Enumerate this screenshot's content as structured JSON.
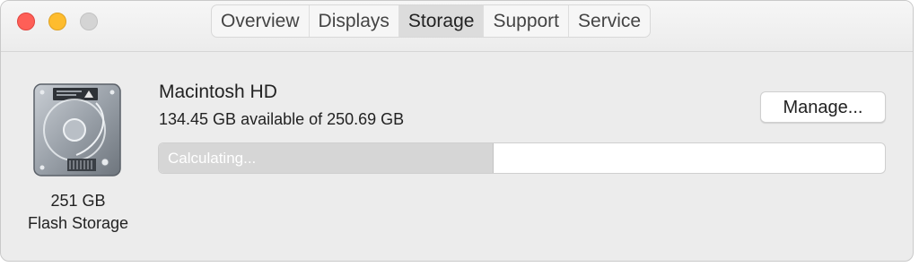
{
  "window": {
    "traffic_lights": {
      "close": "#fe5f57",
      "minimize": "#febc2e",
      "zoom": "#d4d4d4"
    }
  },
  "tabs": [
    {
      "label": "Overview",
      "active": false
    },
    {
      "label": "Displays",
      "active": false
    },
    {
      "label": "Storage",
      "active": true
    },
    {
      "label": "Support",
      "active": false
    },
    {
      "label": "Service",
      "active": false
    }
  ],
  "disk": {
    "icon": "hard-drive-icon",
    "size": "251 GB",
    "type": "Flash Storage"
  },
  "volume": {
    "name": "Macintosh HD",
    "available": "134.45 GB available of 250.69 GB",
    "status": "Calculating...",
    "used_fraction": 0.46
  },
  "manage_button": {
    "label": "Manage..."
  },
  "colors": {
    "window_bg": "#ececec",
    "bar_fill": "#d6d6d6",
    "bar_empty": "#ffffff"
  }
}
